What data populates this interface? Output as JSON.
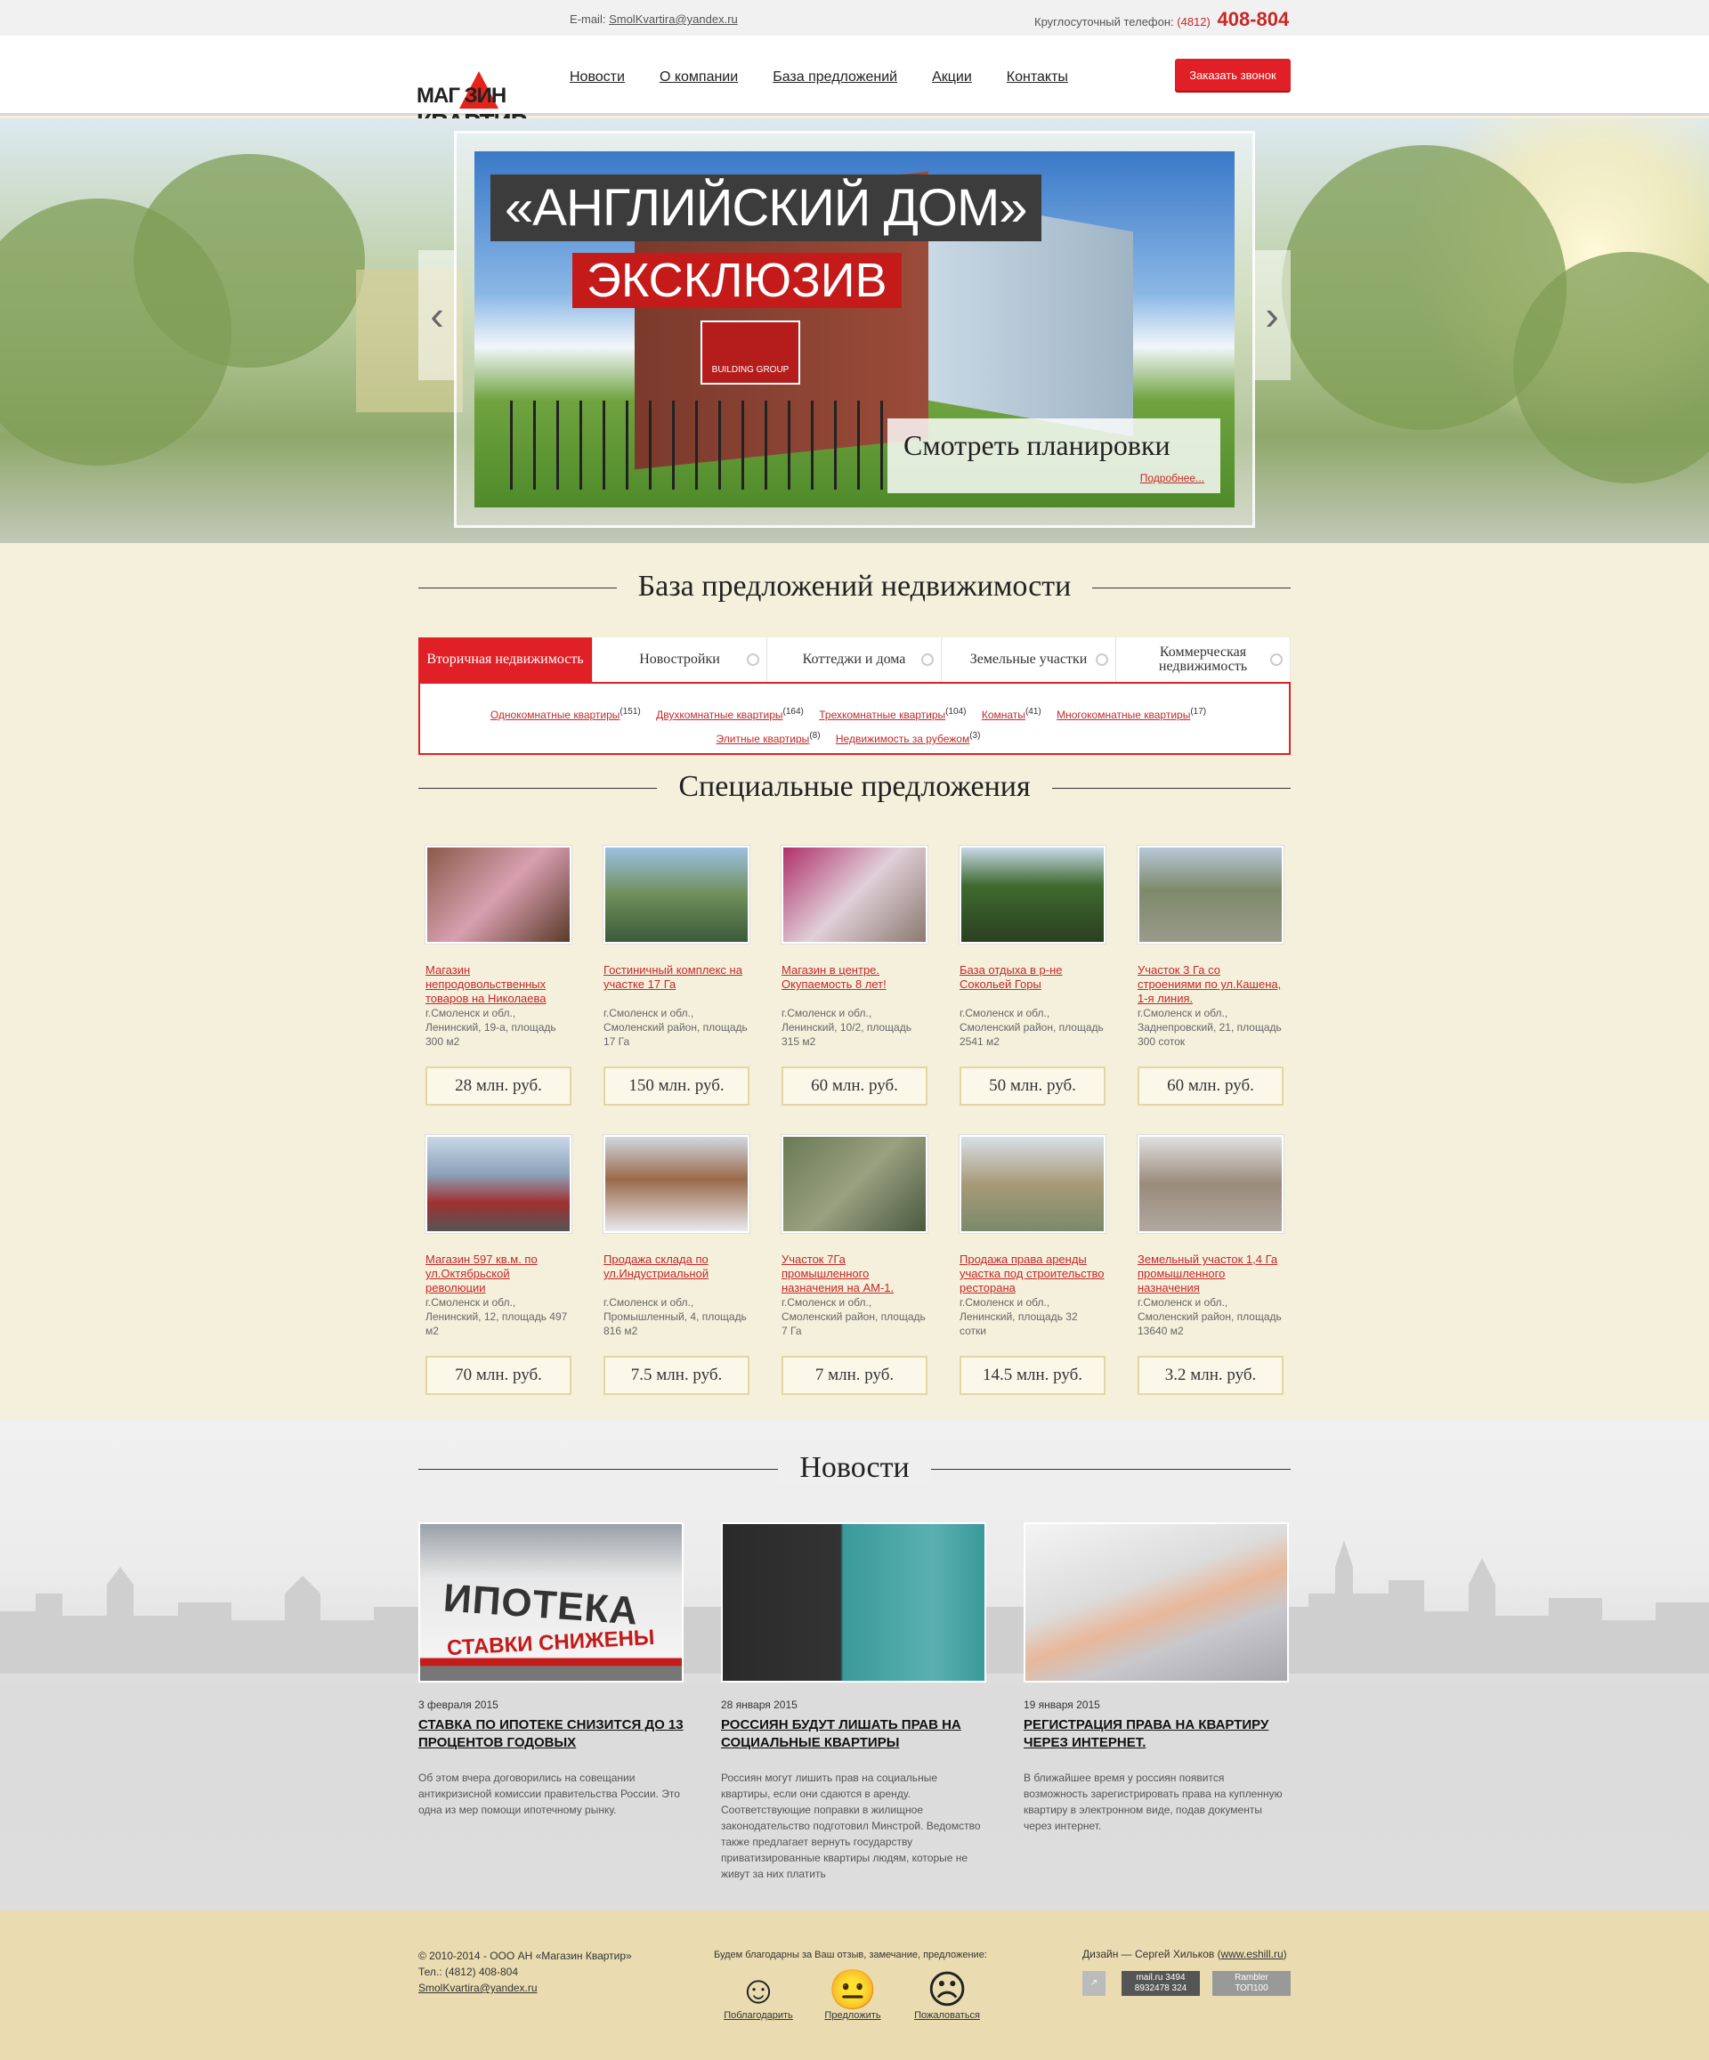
{
  "topbar": {
    "email_label": "E-mail:",
    "email": "SmolKvartira@yandex.ru",
    "phone_label": "Круглосуточный телефон:",
    "phone_code": "(4812)",
    "phone_number": "408-804"
  },
  "logo": {
    "line1": "МАГ ЗИН",
    "line2": "КВАРТИР"
  },
  "nav": [
    "Новости",
    "О компании",
    "База предложений",
    "Акции",
    "Контакты"
  ],
  "callback_button": "Заказать звонок",
  "hero": {
    "title": "«АНГЛИЙСКИЙ ДОМ»",
    "subtitle": "ЭКСКЛЮЗИВ",
    "badge": "BUILDING GROUP",
    "plans": "Смотреть планировки",
    "more": "Подробнее..."
  },
  "db_section": {
    "title": "База предложений недвижимости",
    "tabs": [
      "Вторичная недвижимость",
      "Новостройки",
      "Коттеджи и дома",
      "Земельные участки",
      "Коммерческая недвижимость"
    ],
    "active_tab": 0,
    "links": [
      {
        "label": "Однокомнатные квартиры",
        "count": "(151)"
      },
      {
        "label": "Двухкомнатные квартиры",
        "count": "(164)"
      },
      {
        "label": "Трехкомнатные квартиры",
        "count": "(104)"
      },
      {
        "label": "Комнаты",
        "count": "(41)"
      },
      {
        "label": "Многокомнатные квартиры",
        "count": "(17)"
      },
      {
        "label": "Элитные квартиры",
        "count": "(8)"
      },
      {
        "label": "Недвижимость за рубежом",
        "count": "(3)"
      }
    ]
  },
  "specials": {
    "title": "Специальные предложения",
    "items": [
      {
        "title": "Магазин непродовольственных товаров на Николаева",
        "addr": "г.Смоленск и обл., Ленинский, 19-а, площадь 300 м2",
        "price": "28 млн. руб.",
        "color": "#8a5a4a"
      },
      {
        "title": "Гостиничный комплекс на участке 17 Га",
        "addr": "г.Смоленск и обл., Смоленский район, площадь 17 Га",
        "price": "150 млн. руб.",
        "color": "#6f8f5a"
      },
      {
        "title": "Магазин в центре. Окупаемость 8 лет!",
        "addr": "г.Смоленск и обл., Ленинский, 10/2, площадь 315 м2",
        "price": "60 млн. руб.",
        "color": "#b0306a"
      },
      {
        "title": "База отдыха в р-не Сокольей Горы",
        "addr": "г.Смоленск и обл., Смоленский район, площадь 2541 м2",
        "price": "50 млн. руб.",
        "color": "#3f6b30"
      },
      {
        "title": "Участок 3 Га со строениями по ул.Кашена, 1-я линия.",
        "addr": "г.Смоленск и обл., Заднепровский, 21, площадь 300 соток",
        "price": "60 млн. руб.",
        "color": "#7d8a6a"
      },
      {
        "title": "Магазин 597 кв.м. по ул.Октябрьской революции",
        "addr": "г.Смоленск и обл., Ленинский, 12, площадь 497 м2",
        "price": "70 млн. руб.",
        "color": "#8ca0b8"
      },
      {
        "title": "Продажа склада по ул.Индустриальной",
        "addr": "г.Смоленск и обл., Промышленный, 4, площадь 816 м2",
        "price": "7.5 млн. руб.",
        "color": "#9a6a4a"
      },
      {
        "title": "Участок 7Га промышленного назначения на АМ-1.",
        "addr": "г.Смоленск и обл., Смоленский район, площадь 7 Га",
        "price": "7 млн. руб.",
        "color": "#6a7a55"
      },
      {
        "title": "Продажа права аренды участка под строительство ресторана",
        "addr": "г.Смоленск и обл., Ленинский, площадь 32 сотки",
        "price": "14.5 млн. руб.",
        "color": "#a89a78"
      },
      {
        "title": "Земельный участок 1,4 Га промышленного назначения",
        "addr": "г.Смоленск и обл., Смоленский район, площадь 13640 м2",
        "price": "3.2 млн. руб.",
        "color": "#9a8a7a"
      }
    ]
  },
  "news": {
    "title": "Новости",
    "items": [
      {
        "date": "3 февраля 2015",
        "title": "СТАВКА ПО ИПОТЕКЕ СНИЗИТСЯ ДО 13 ПРОЦЕНТОВ ГОДОВЫХ",
        "body": "Об этом вчера договорились на совещании антикризисной комиссии правительства России. Это одна из мер помощи ипотечному рынку.",
        "img_text1": "ИПОТЕКА",
        "img_text2": "СТАВКИ СНИЖЕНЫ"
      },
      {
        "date": "28 января 2015",
        "title": "РОССИЯН БУДУТ ЛИШАТЬ ПРАВ НА СОЦИАЛЬНЫЕ КВАРТИРЫ",
        "body": "Россиян могут лишить прав на социальные квартиры, если они сдаются в аренду. Соответствующие поправки в жилищное законодательство подготовил Минстрой. Ведомство также предлагает вернуть государству приватизированные квартиры людям, которые не живут за них платить"
      },
      {
        "date": "19 января 2015",
        "title": "РЕГИСТРАЦИЯ ПРАВА НА КВАРТИРУ ЧЕРЕЗ ИНТЕРНЕТ.",
        "body": "В ближайшее время у россиян появится возможность зарегистрировать права на купленную квартиру в электронном виде, подав документы через интернет."
      }
    ]
  },
  "footer": {
    "copyright": "© 2010-2014 - ООО АН «Магазин Квартир»",
    "phone": "Тел.: (4812) 408-804",
    "email": "SmolKvartira@yandex.ru",
    "feedback_text": "Будем благодарны за Ваш отзыв, замечание, предложение:",
    "feedback": [
      {
        "label": "Поблагодарить",
        "icon": "smile-icon"
      },
      {
        "label": "Предложить",
        "icon": "neutral-face-icon"
      },
      {
        "label": "Пожаловаться",
        "icon": "sad-face-icon"
      }
    ],
    "design_label": "Дизайн — Сергей Хильков",
    "design_link": "www.eshill.ru",
    "counters": [
      "mail.ru",
      "8932478",
      "3494",
      "324",
      "Rambler",
      "ТОП100"
    ]
  },
  "colors": {
    "accent": "#e01f26",
    "link": "#c62828",
    "background": "#f5f0dc",
    "footer": "#eadcb0"
  }
}
